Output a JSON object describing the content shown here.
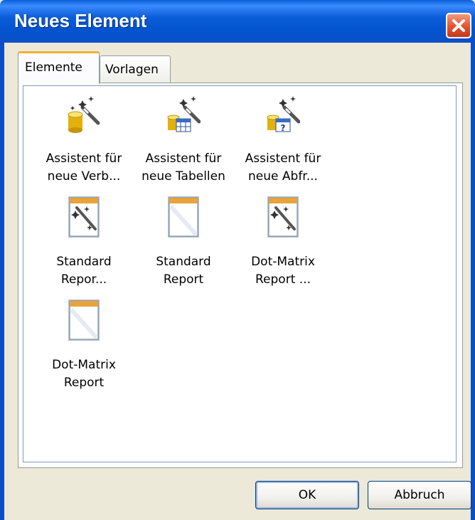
{
  "window": {
    "title": "Neues Element"
  },
  "tabs": [
    {
      "label": "Elemente",
      "active": true
    },
    {
      "label": "Vorlagen",
      "active": false
    }
  ],
  "items": [
    {
      "icon": "wizard-database-icon",
      "label": "Assistent für\nneue Verb..."
    },
    {
      "icon": "wizard-table-icon",
      "label": "Assistent für\nneue Tabellen"
    },
    {
      "icon": "wizard-query-icon",
      "label": "Assistent für\nneue Abfr..."
    },
    {
      "icon": "report-wizard-icon",
      "label": "Standard\nRepor..."
    },
    {
      "icon": "report-icon",
      "label": "Standard\nReport"
    },
    {
      "icon": "report-wizard-icon",
      "label": "Dot-Matrix\nReport ..."
    },
    {
      "icon": "report-icon",
      "label": "Dot-Matrix\nReport"
    }
  ],
  "buttons": {
    "ok": "OK",
    "cancel": "Abbruch"
  },
  "colors": {
    "titlebar": "#0b5dd8",
    "tab_accent": "#f5b030",
    "close": "#e0542f"
  }
}
